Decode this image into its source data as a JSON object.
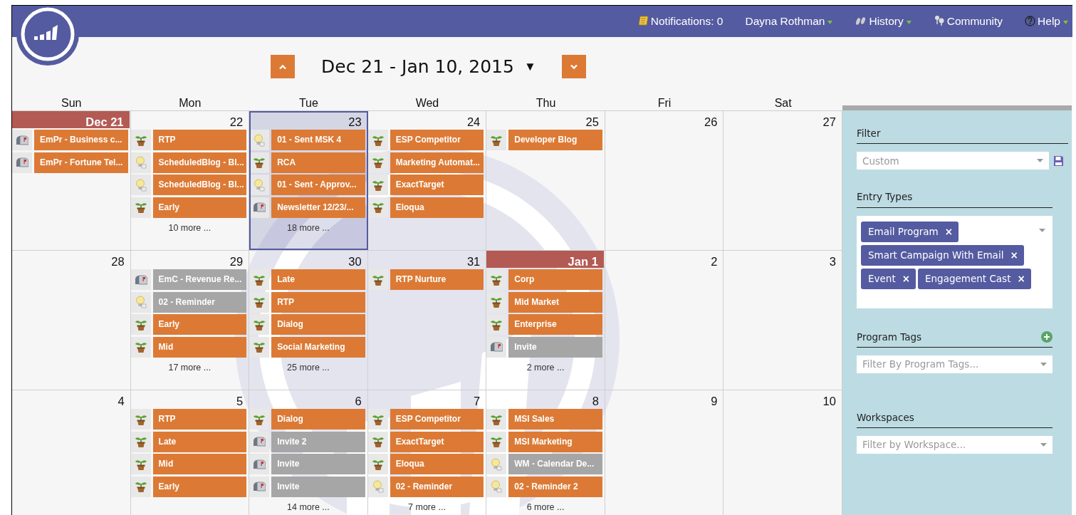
{
  "top_bar": {
    "items": [
      {
        "kind": "notifications",
        "label": "Notifications: 0",
        "dropdown": false
      },
      {
        "kind": "user",
        "label": "Dayna Rothman",
        "dropdown": true
      },
      {
        "kind": "history",
        "label": "History",
        "dropdown": true
      },
      {
        "kind": "community",
        "label": "Community",
        "dropdown": false
      },
      {
        "kind": "help",
        "label": "Help",
        "dropdown": true
      }
    ]
  },
  "date_nav": {
    "range": "Dec 21 - Jan 10, 2015",
    "dropdown_glyph": "▼"
  },
  "calendar": {
    "weekdays": [
      "Sun",
      "Mon",
      "Tue",
      "Wed",
      "Thu",
      "Fri",
      "Sat"
    ],
    "weeks": [
      {
        "days": [
          {
            "date": "Dec 21",
            "month_start": true,
            "selected": false,
            "events": [
              {
                "kind": "email",
                "label": "EmPr - Business c...",
                "color": "#dc7a35"
              },
              {
                "kind": "email",
                "label": "EmPr - Fortune Tel...",
                "color": "#dc7a35"
              }
            ]
          },
          {
            "date": "22",
            "month_start": false,
            "selected": false,
            "events": [
              {
                "kind": "program",
                "label": "RTP",
                "color": "#dc7a35"
              },
              {
                "kind": "idea",
                "label": "ScheduledBlog - Bl...",
                "color": "#dc7a35"
              },
              {
                "kind": "idea",
                "label": "ScheduledBlog - Bl...",
                "color": "#dc7a35"
              },
              {
                "kind": "program",
                "label": "Early",
                "color": "#dc7a35"
              }
            ],
            "more": "10 more ..."
          },
          {
            "date": "23",
            "month_start": false,
            "selected": true,
            "events": [
              {
                "kind": "idea",
                "label": "01 - Sent MSK 4",
                "color": "#dc7a35"
              },
              {
                "kind": "program",
                "label": "RCA",
                "color": "#dc7a35"
              },
              {
                "kind": "idea",
                "label": "01 - Sent - Approv...",
                "color": "#dc7a35"
              },
              {
                "kind": "email",
                "label": "Newsletter 12/23/...",
                "color": "#dc7a35"
              }
            ],
            "more": "18 more ..."
          },
          {
            "date": "24",
            "month_start": false,
            "selected": false,
            "events": [
              {
                "kind": "program",
                "label": "ESP Competitor",
                "color": "#dc7a35"
              },
              {
                "kind": "program",
                "label": "Marketing Automat...",
                "color": "#dc7a35"
              },
              {
                "kind": "program",
                "label": "ExactTarget",
                "color": "#dc7a35"
              },
              {
                "kind": "program",
                "label": "Eloqua",
                "color": "#dc7a35"
              }
            ]
          },
          {
            "date": "25",
            "month_start": false,
            "selected": false,
            "events": [
              {
                "kind": "program",
                "label": "Developer Blog",
                "color": "#dc7a35"
              }
            ]
          },
          {
            "date": "26",
            "month_start": false,
            "selected": false
          },
          {
            "date": "27",
            "month_start": false,
            "selected": false
          }
        ]
      },
      {
        "days": [
          {
            "date": "28",
            "month_start": false,
            "selected": false
          },
          {
            "date": "29",
            "month_start": false,
            "selected": false,
            "events": [
              {
                "kind": "email",
                "label": "EmC - Revenue Re...",
                "color": "#a6a6a6"
              },
              {
                "kind": "idea",
                "label": "02 - Reminder",
                "color": "#a6a6a6"
              },
              {
                "kind": "program",
                "label": "Early",
                "color": "#dc7a35"
              },
              {
                "kind": "program",
                "label": "Mid",
                "color": "#dc7a35"
              }
            ],
            "more": "17 more ..."
          },
          {
            "date": "30",
            "month_start": false,
            "selected": false,
            "events": [
              {
                "kind": "program",
                "label": "Late",
                "color": "#dc7a35"
              },
              {
                "kind": "program",
                "label": "RTP",
                "color": "#dc7a35"
              },
              {
                "kind": "program",
                "label": "Dialog",
                "color": "#dc7a35"
              },
              {
                "kind": "program",
                "label": "Social Marketing",
                "color": "#dc7a35"
              }
            ],
            "more": "25 more ..."
          },
          {
            "date": "31",
            "month_start": false,
            "selected": false,
            "events": [
              {
                "kind": "program",
                "label": "RTP Nurture",
                "color": "#dc7a35"
              }
            ]
          },
          {
            "date": "Jan 1",
            "month_start": true,
            "selected": false,
            "events": [
              {
                "kind": "program",
                "label": "Corp",
                "color": "#dc7a35"
              },
              {
                "kind": "program",
                "label": "Mid Market",
                "color": "#dc7a35"
              },
              {
                "kind": "program",
                "label": "Enterprise",
                "color": "#dc7a35"
              },
              {
                "kind": "email",
                "label": "Invite",
                "color": "#a6a6a6"
              }
            ],
            "more": "2 more ..."
          },
          {
            "date": "2",
            "month_start": false,
            "selected": false
          },
          {
            "date": "3",
            "month_start": false,
            "selected": false
          }
        ]
      },
      {
        "days": [
          {
            "date": "4",
            "month_start": false,
            "selected": false
          },
          {
            "date": "5",
            "month_start": false,
            "selected": false,
            "events": [
              {
                "kind": "program",
                "label": "RTP",
                "color": "#dc7a35"
              },
              {
                "kind": "program",
                "label": "Late",
                "color": "#dc7a35"
              },
              {
                "kind": "program",
                "label": "Mid",
                "color": "#dc7a35"
              },
              {
                "kind": "program",
                "label": "Early",
                "color": "#dc7a35"
              }
            ]
          },
          {
            "date": "6",
            "month_start": false,
            "selected": false,
            "events": [
              {
                "kind": "program",
                "label": "Dialog",
                "color": "#dc7a35"
              },
              {
                "kind": "email",
                "label": "Invite 2",
                "color": "#a6a6a6"
              },
              {
                "kind": "email",
                "label": "Invite",
                "color": "#a6a6a6"
              },
              {
                "kind": "email",
                "label": "Invite",
                "color": "#a6a6a6"
              }
            ],
            "more": "14 more ..."
          },
          {
            "date": "7",
            "month_start": false,
            "selected": false,
            "events": [
              {
                "kind": "program",
                "label": "ESP Competitor",
                "color": "#dc7a35"
              },
              {
                "kind": "program",
                "label": "ExactTarget",
                "color": "#dc7a35"
              },
              {
                "kind": "program",
                "label": "Eloqua",
                "color": "#dc7a35"
              },
              {
                "kind": "idea",
                "label": "02 - Reminder",
                "color": "#dc7a35"
              }
            ],
            "more": "7 more ..."
          },
          {
            "date": "8",
            "month_start": false,
            "selected": false,
            "events": [
              {
                "kind": "program",
                "label": "MSI Sales",
                "color": "#dc7a35"
              },
              {
                "kind": "program",
                "label": "MSI Marketing",
                "color": "#dc7a35"
              },
              {
                "kind": "idea",
                "label": "WM - Calendar De...",
                "color": "#a6a6a6"
              },
              {
                "kind": "idea",
                "label": "02 - Reminder 2",
                "color": "#dc7a35"
              }
            ],
            "more": "6 more ..."
          },
          {
            "date": "9",
            "month_start": false,
            "selected": false
          },
          {
            "date": "10",
            "month_start": false,
            "selected": false
          }
        ]
      }
    ]
  },
  "sidebar": {
    "filter": {
      "title": "Filter",
      "placeholder": "Custom"
    },
    "entry_types": {
      "title": "Entry Types",
      "tags": [
        {
          "label": "Email Program",
          "remove": "×"
        },
        {
          "label": "Smart Campaign With Email",
          "remove": "×"
        },
        {
          "label": "Event",
          "remove": "×"
        },
        {
          "label": "Engagement Cast",
          "remove": "×"
        }
      ]
    },
    "program_tags": {
      "title": "Program Tags",
      "placeholder": "Filter By Program Tags..."
    },
    "workspaces": {
      "title": "Workspaces",
      "placeholder": "Filter by Workspace..."
    }
  }
}
